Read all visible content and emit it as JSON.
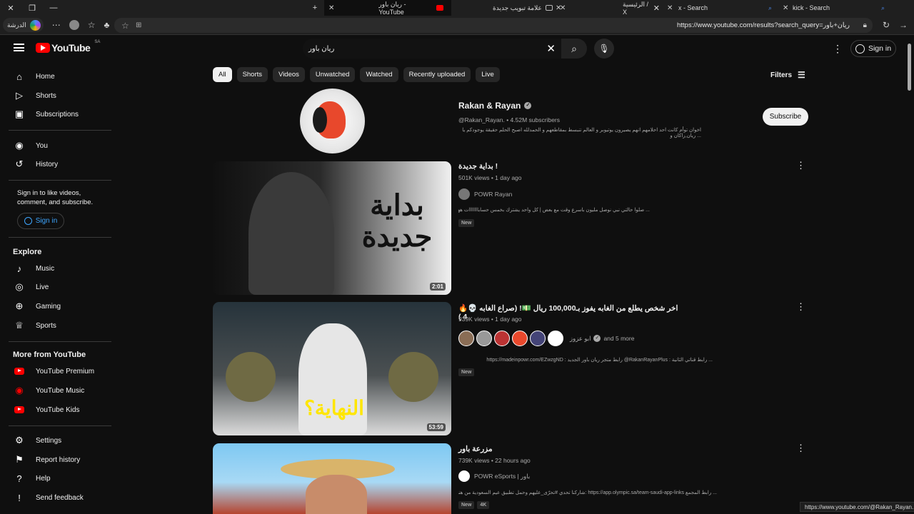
{
  "browser": {
    "tabs": [
      {
        "title": "ريان باور - YouTube",
        "active": true
      },
      {
        "title": "علامة تبويب جديدة",
        "active": false
      },
      {
        "title": "الرئيسية / X",
        "active": false
      },
      {
        "title": "x - Search",
        "active": false
      },
      {
        "title": "kick - Search",
        "active": false
      }
    ],
    "profile_label": "الدرشة",
    "url": "https://www.youtube.com/results?search_query=ريان+باور",
    "status_url": "https://www.youtube.com/@Rakan_Rayan."
  },
  "header": {
    "logo_text": "YouTube",
    "country_code": "SA",
    "search_value": "ريان باور",
    "sign_in_label": "Sign in"
  },
  "sidebar": {
    "main": [
      {
        "label": "Home",
        "icon": "home-icon"
      },
      {
        "label": "Shorts",
        "icon": "shorts-icon"
      },
      {
        "label": "Subscriptions",
        "icon": "subscriptions-icon"
      }
    ],
    "you": [
      {
        "label": "You",
        "icon": "you-icon"
      },
      {
        "label": "History",
        "icon": "history-icon"
      }
    ],
    "sign_in_prompt": "Sign in to like videos, comment, and subscribe.",
    "sign_in_label": "Sign in",
    "explore_heading": "Explore",
    "explore": [
      {
        "label": "Music",
        "icon": "music-icon"
      },
      {
        "label": "Live",
        "icon": "live-icon"
      },
      {
        "label": "Gaming",
        "icon": "gaming-icon"
      },
      {
        "label": "Sports",
        "icon": "trophy-icon"
      }
    ],
    "more_heading": "More from YouTube",
    "more": [
      {
        "label": "YouTube Premium"
      },
      {
        "label": "YouTube Music"
      },
      {
        "label": "YouTube Kids"
      }
    ],
    "footer": [
      {
        "label": "Settings",
        "icon": "gear-icon"
      },
      {
        "label": "Report history",
        "icon": "flag-icon"
      },
      {
        "label": "Help",
        "icon": "help-icon"
      },
      {
        "label": "Send feedback",
        "icon": "feedback-icon"
      }
    ]
  },
  "chips": [
    "All",
    "Shorts",
    "Videos",
    "Unwatched",
    "Watched",
    "Recently uploaded",
    "Live"
  ],
  "filters_label": "Filters",
  "channel": {
    "name": "Rakan & Rayan",
    "handle_subs": "@Rakan_Rayan. • 4.52M subscribers",
    "description": "اخوان توأم كانت احد احلامهم انهم يصيرون يوتيوبر و العالم تنبسط بمقاطعهم و الحمدلله اصبح الحلم حقيقة يوجودكم يا ... ريان,راكان و",
    "subscribe_label": "Subscribe"
  },
  "videos": [
    {
      "title": "بداية جديدة !",
      "meta": "501K views • 1 day ago",
      "channel": "POWR Rayan",
      "description": "... صلوا حالتي نبي نوصل مليون باسرع وقت مع بعض | كل واحد يشترك بخمس حسابااااااات ههههه",
      "badges": [
        "New"
      ],
      "duration": "2:01",
      "thumb_text": "بداية جديدة"
    },
    {
      "title": "اخر شخص يطلع من الغابه يفوز بـ100,000 ريال 💵! (صراع الغابه 💀🔥 4 )",
      "meta": "939K views • 1 day ago",
      "channel": "ابو عزوز",
      "channel_more": "and 5 more",
      "description": "... رابط قناتي الثانية : RakanRayanPlus@ رابط متجر ريان باور الجديد : https://madeinpowr.com/EZwzgND",
      "badges": [
        "New"
      ],
      "duration": "53:59",
      "thumb_text": "النهاية؟"
    },
    {
      "title": "مزرعة باور",
      "meta": "739K views • 22 hours ago",
      "channel": "POWR eSports | باور",
      "description": "... رابط المجمع https://app.olympic.sa/team-saudi-app-links :شاركنا تحدي #تحرّى_عليهم وحمل تطبيق عيم السعودية من هنا",
      "badges": [
        "New",
        "4K"
      ],
      "duration": ""
    }
  ],
  "colors": {
    "background": "#0f0f0f",
    "accent_red": "#ff0000",
    "link_blue": "#3ea6ff",
    "chip_bg": "#272727"
  }
}
